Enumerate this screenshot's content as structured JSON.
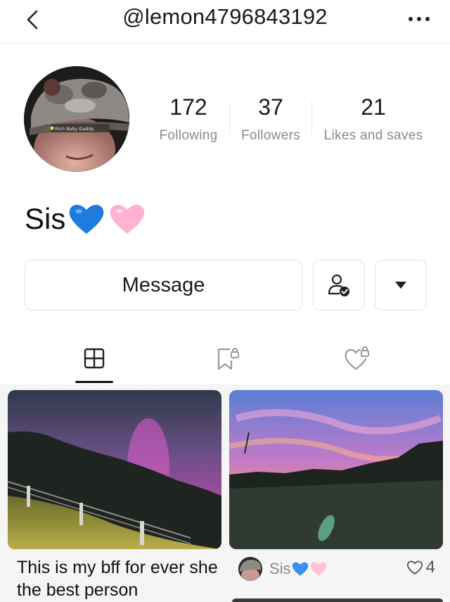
{
  "header": {
    "handle": "@lemon4796843192",
    "back_icon": "chevron-left-icon",
    "more_icon": "more-horizontal-icon"
  },
  "profile": {
    "avatar_overlay_text": "Rich Baby Daddy",
    "display_name": "Sis",
    "name_emojis": [
      "blue-heart",
      "pink-heart"
    ],
    "stats": [
      {
        "value": "172",
        "label": "Following"
      },
      {
        "value": "37",
        "label": "Followers"
      },
      {
        "value": "21",
        "label": "Likes and saves"
      }
    ]
  },
  "actions": {
    "message_label": "Message",
    "follow_icon": "user-check-icon",
    "dropdown_icon": "caret-down-icon"
  },
  "tabs": [
    {
      "icon": "grid-icon",
      "active": true
    },
    {
      "icon": "bookmark-lock-icon",
      "active": false
    },
    {
      "icon": "heart-lock-icon",
      "active": false
    }
  ],
  "posts": [
    {
      "caption": "This is my bff for ever she the best person",
      "image": "aurora-night-field"
    },
    {
      "author": "Sis",
      "author_emojis": [
        "blue-heart",
        "pink-heart"
      ],
      "likes": "4",
      "image": "sunset-sky"
    }
  ],
  "colors": {
    "accent": "#111111",
    "muted_text": "#8a8a8a",
    "border": "#e2e2e2",
    "blue_heart": "#1e7be0",
    "pink_heart": "#ffb3d1"
  }
}
